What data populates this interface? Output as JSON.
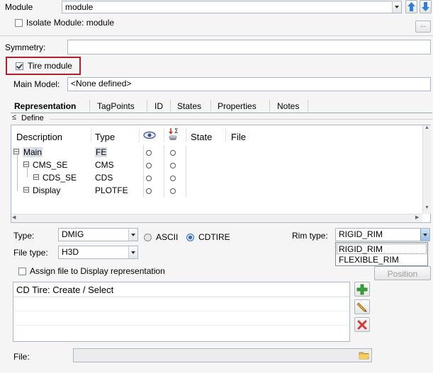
{
  "module": {
    "label": "Module",
    "value": "module"
  },
  "isolate": {
    "label": "Isolate Module: module",
    "checked": false
  },
  "ellipsis_label": "...",
  "symmetry": {
    "label": "Symmetry:",
    "value": ""
  },
  "tire_module": {
    "label": "Tire module",
    "checked": true
  },
  "main_model": {
    "label": "Main Model:",
    "value": "<None defined>"
  },
  "tabs": [
    "Representation",
    "TagPoints",
    "ID",
    "States",
    "Properties",
    "Notes"
  ],
  "define_label": "Define",
  "columns": [
    "Description",
    "Type",
    "State",
    "File"
  ],
  "rows": [
    {
      "description": "Main",
      "type": "FE",
      "expander": "⊟"
    },
    {
      "description": "CMS_SE",
      "type": "CMS",
      "expander": "⊟"
    },
    {
      "description": "CDS_SE",
      "type": "CDS",
      "expander": "⊟"
    },
    {
      "description": "Display",
      "type": "PLOTFE",
      "expander": "⊟"
    }
  ],
  "type_field": {
    "label": "Type:",
    "value": "DMIG"
  },
  "format_options": {
    "ascii": "ASCII",
    "cdtire": "CDTIRE",
    "selected": "CDTIRE"
  },
  "rim_type": {
    "label": "Rim type:",
    "value": "RIGID_RIM",
    "options": [
      "RIGID_RIM",
      "FLEXIBLE_RIM"
    ]
  },
  "file_type": {
    "label": "File type:",
    "value": "H3D"
  },
  "assign": {
    "label": "Assign file to Display representation",
    "checked": false
  },
  "position_label": "Position",
  "cd_tire": {
    "header": "CD Tire: Create / Select"
  },
  "file_field": {
    "label": "File:",
    "value": ""
  },
  "colors": {
    "highlight_box": "#b0202a",
    "accent_blue": "#2f7fd6",
    "add_green": "#3aa23a",
    "delete_red": "#d43a3a"
  }
}
